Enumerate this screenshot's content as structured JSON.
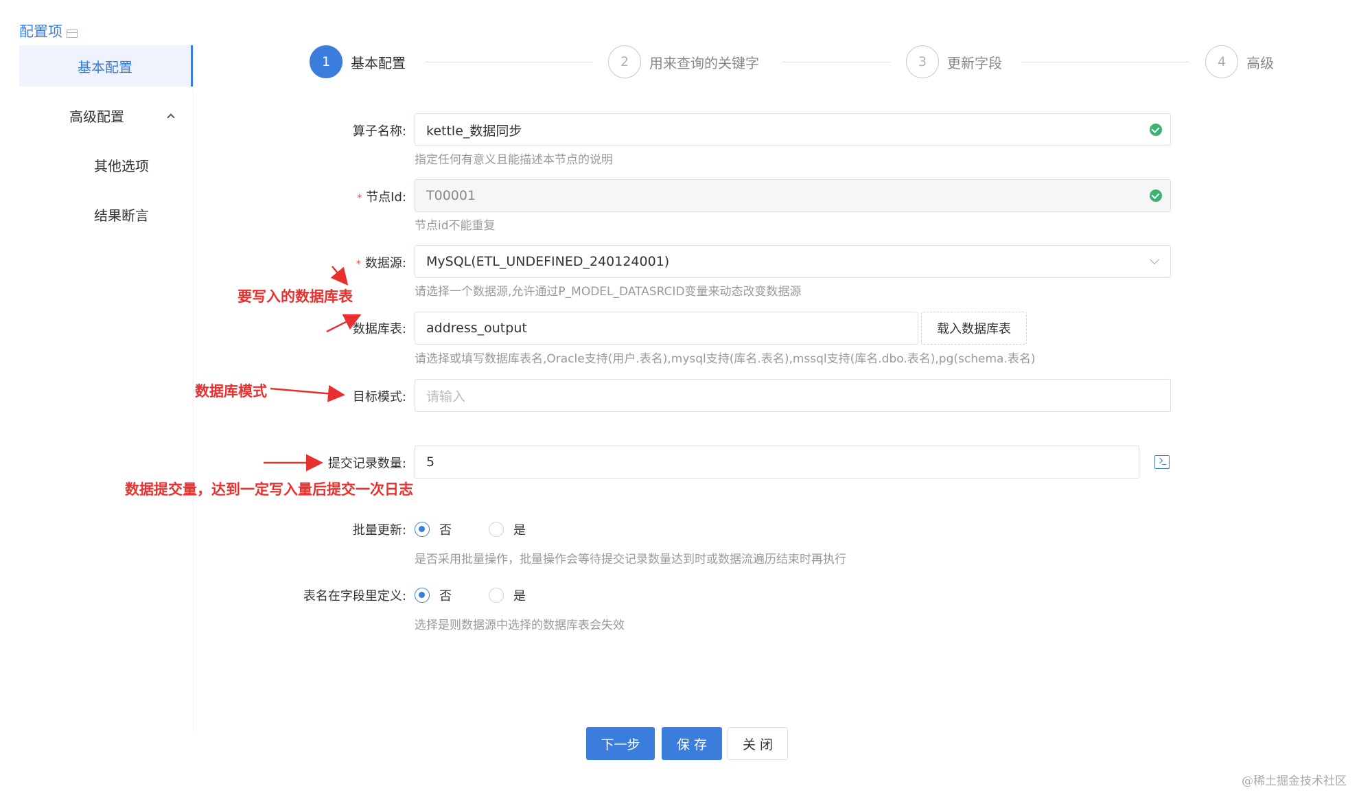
{
  "sidebar": {
    "title": "配置项",
    "items": [
      {
        "label": "基本配置"
      },
      {
        "label": "高级配置"
      },
      {
        "label": "其他选项"
      },
      {
        "label": "结果断言"
      }
    ]
  },
  "steps": [
    {
      "num": "1",
      "label": "基本配置"
    },
    {
      "num": "2",
      "label": "用来查询的关键字"
    },
    {
      "num": "3",
      "label": "更新字段"
    },
    {
      "num": "4",
      "label": "高级"
    }
  ],
  "form": {
    "operator_name": {
      "label": "算子名称:",
      "value": "kettle_数据同步",
      "help": "指定任何有意义且能描述本节点的说明"
    },
    "node_id": {
      "label": "节点Id:",
      "value": "T00001",
      "help": "节点id不能重复"
    },
    "datasource": {
      "label": "数据源:",
      "value": "MySQL(ETL_UNDEFINED_240124001)",
      "help": "请选择一个数据源,允许通过P_MODEL_DATASRCID变量来动态改变数据源"
    },
    "table": {
      "label": "数据库表:",
      "value": "address_output",
      "button": "载入数据库表",
      "help": "请选择或填写数据库表名,Oracle支持(用户.表名),mysql支持(库名.表名),mssql支持(库名.dbo.表名),pg(schema.表名)"
    },
    "target_schema": {
      "label": "目标模式:",
      "placeholder": "请输入"
    },
    "commit_size": {
      "label": "提交记录数量:",
      "value": "5"
    },
    "batch_update": {
      "label": "批量更新:",
      "opt_no": "否",
      "opt_yes": "是",
      "help": "是否采用批量操作，批量操作会等待提交记录数量达到时或数据流遍历结束时再执行"
    },
    "table_in_field": {
      "label": "表名在字段里定义:",
      "opt_no": "否",
      "opt_yes": "是",
      "help": "选择是则数据源中选择的数据库表会失效"
    }
  },
  "annotations": {
    "table": "要写入的数据库表",
    "schema": "数据库模式",
    "commit": "数据提交量，达到一定写入量后提交一次日志"
  },
  "footer": {
    "next": "下一步",
    "save": "保 存",
    "close": "关 闭"
  },
  "watermark": "@稀土掘金技术社区",
  "colors": {
    "primary": "#3b7ddd",
    "annotation": "#e8312f",
    "success": "#3cb371"
  }
}
